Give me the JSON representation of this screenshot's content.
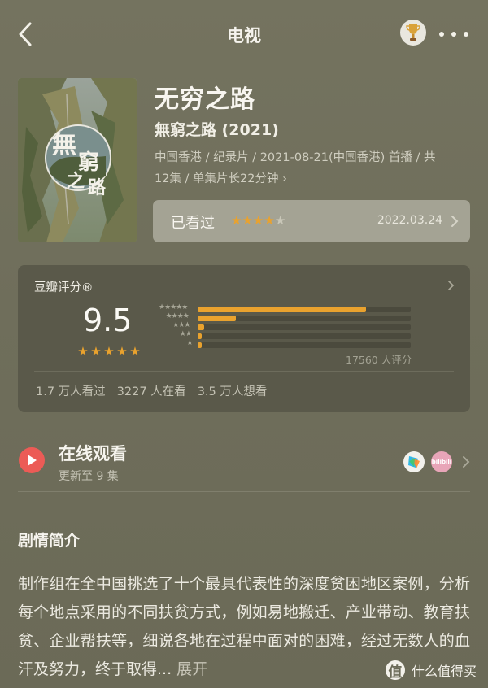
{
  "nav": {
    "title": "电视"
  },
  "movie": {
    "poster_title": "無窮之路",
    "title": "无穷之路",
    "original_title": "無窮之路 (2021)",
    "meta_line1": "中国香港 / 纪录片 / 2021-08-21(中国香港) 首播 / 共",
    "meta_line2": "12集 / 单集片长22分钟",
    "meta_chevron": "›"
  },
  "my_status": {
    "label": "已看过",
    "stars": 4,
    "max_stars": 5,
    "date": "2022.03.24"
  },
  "rating": {
    "source": "豆瓣评分®",
    "score": "9.5",
    "stars": 5,
    "distribution": [
      {
        "stars": "★★★★★",
        "fraction": 0.79
      },
      {
        "stars": "★★★★",
        "fraction": 0.18
      },
      {
        "stars": "★★★",
        "fraction": 0.03
      },
      {
        "stars": "★★",
        "fraction": 0.02
      },
      {
        "stars": "★",
        "fraction": 0.02
      }
    ],
    "votes": "17560 人评分",
    "stats": [
      "1.7 万人看过",
      "3227 人在看",
      "3.5 万人想看"
    ]
  },
  "watch": {
    "title": "在线观看",
    "subtitle": "更新至 9 集",
    "provider2_label": "bilibili"
  },
  "synopsis": {
    "heading": "剧情简介",
    "text": "制作组在全中国挑选了十个最具代表性的深度贫困地区案例，分析每个地点采用的不同扶贫方式，例如易地搬迁、产业带动、教育扶贫、企业帮扶等，细说各地在过程中面对的困难，经过无数人的血汗及努力，终于取得...",
    "expand": " 展开"
  },
  "watermark": {
    "logo": "值",
    "text": "什么值得买"
  },
  "colors": {
    "accent_star": "#e9a22e",
    "star_empty": "#c9c7b8",
    "play_red": "#ec5b56"
  }
}
